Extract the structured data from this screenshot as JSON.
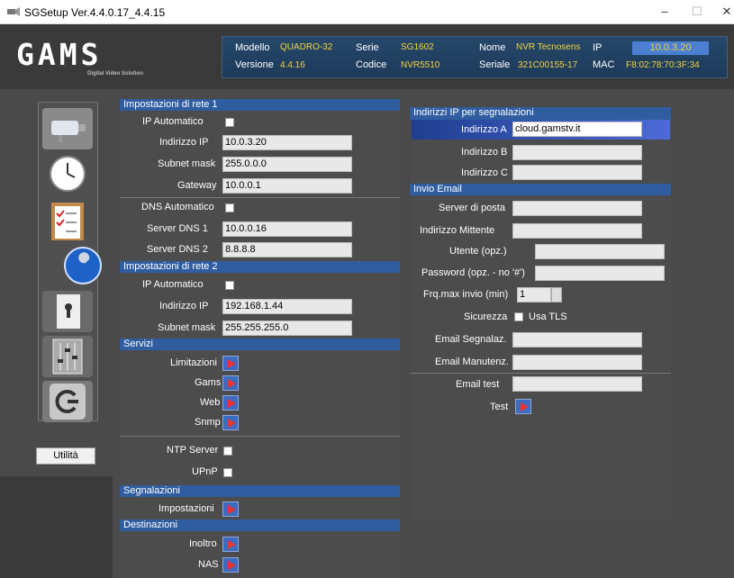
{
  "window": {
    "title": "SGSetup Ver.4.4.0.17_4.4.15"
  },
  "header": {
    "logo": "GAMS",
    "logo_sub": "Digital Video Solution",
    "modello_label": "Modello",
    "modello": "QUADRO-32",
    "versione_label": "Versione",
    "versione": "4.4.16",
    "serie_label": "Serie",
    "serie": "SG1602",
    "codice_label": "Codice",
    "codice": "NVR5510",
    "nome_label": "Nome",
    "nome": "NVR Tecnosens",
    "seriale_label": "Seriale",
    "seriale": "321C00155-17",
    "ip_label": "IP",
    "ip": "10.0.3.20",
    "mac_label": "MAC",
    "mac": "F8:02:78:70:3F:34"
  },
  "sidebar": {
    "utilita": "Utilità"
  },
  "rete1": {
    "title": "Impostazioni di rete 1",
    "ip_auto": "IP Automatico",
    "ip_label": "Indirizzo IP",
    "ip": "10.0.3.20",
    "mask_label": "Subnet mask",
    "mask": "255.0.0.0",
    "gw_label": "Gateway",
    "gw": "10.0.0.1",
    "dns_auto": "DNS Automatico",
    "dns1_label": "Server DNS 1",
    "dns1": "10.0.0.16",
    "dns2_label": "Server DNS 2",
    "dns2": "8.8.8.8"
  },
  "rete2": {
    "title": "Impostazioni di rete 2",
    "ip_auto": "IP Automatico",
    "ip_label": "Indirizzo IP",
    "ip": "192.168.1.44",
    "mask_label": "Subnet mask",
    "mask": "255.255.255.0"
  },
  "servizi": {
    "title": "Servizi",
    "limitazioni": "Limitazioni",
    "gams": "Gams",
    "web": "Web",
    "snmp": "Snmp",
    "ntp": "NTP Server",
    "upnp": "UPnP"
  },
  "segnalazioni": {
    "title": "Segnalazioni",
    "impostazioni": "Impostazioni"
  },
  "destinazioni": {
    "title": "Destinazioni",
    "inoltro": "Inoltro",
    "nas": "NAS"
  },
  "indirizzi": {
    "title": "Indirizzi IP per segnalazioni",
    "a_label": "Indirizzo A",
    "a": "cloud.gamstv.it",
    "b_label": "Indirizzo B",
    "c_label": "Indirizzo C"
  },
  "email": {
    "title": "Invio Email",
    "server": "Server di posta",
    "mittente": "Indirizzo Mittente",
    "utente": "Utente (opz.)",
    "password": "Password (opz. - no '#')",
    "frq": "Frq.max invio (min)",
    "frq_val": "1",
    "sicurezza": "Sicurezza",
    "tls": "Usa TLS",
    "segnalaz": "Email Segnalaz.",
    "manutenz": "Email Manutenz.",
    "test_label": "Email test",
    "test": "Test"
  }
}
